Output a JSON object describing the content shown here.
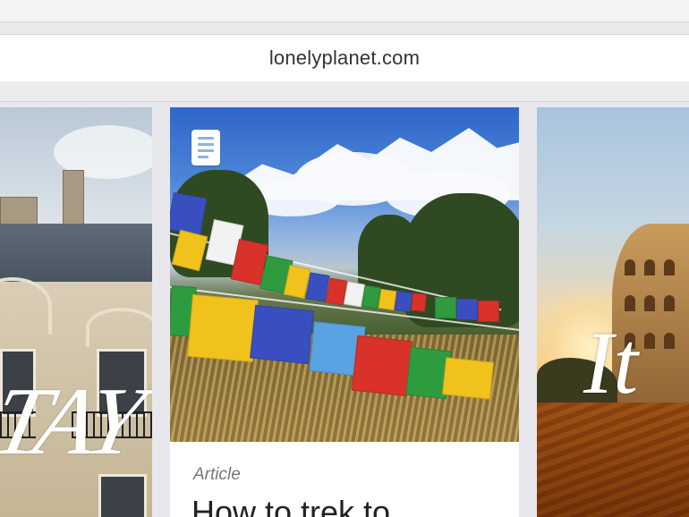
{
  "browser": {
    "url": "lonelyplanet.com"
  },
  "cards": {
    "left": {
      "overlay_text": "TAY"
    },
    "center": {
      "type_label": "Article",
      "title": "How to trek to"
    },
    "right": {
      "overlay_text": "It"
    }
  },
  "icons": {
    "document": "document-icon"
  },
  "colors": {
    "url_text": "#333333",
    "meta_text": "#777777",
    "sky_blue": "#2f66c9"
  }
}
